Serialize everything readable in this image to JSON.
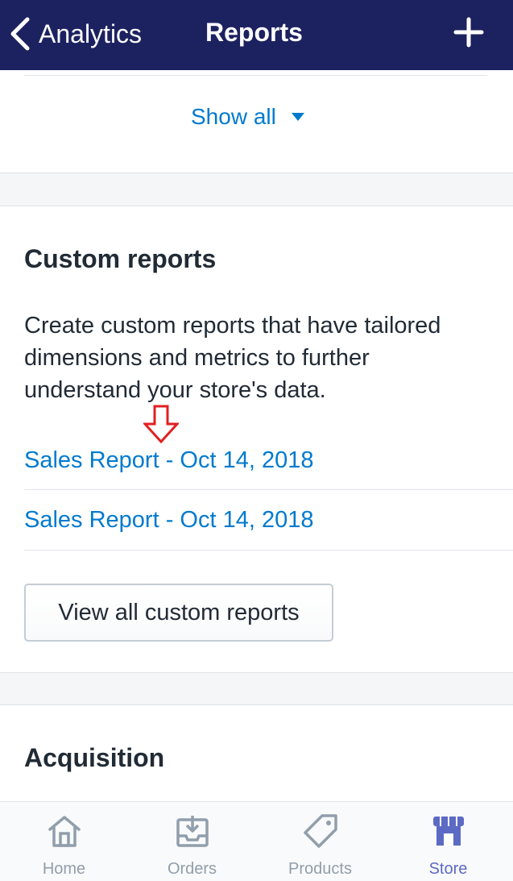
{
  "nav": {
    "back_label": "Analytics",
    "title": "Reports"
  },
  "show_all": {
    "label": "Show all"
  },
  "custom_reports": {
    "heading": "Custom reports",
    "description": "Create custom reports that have tailored dimensions and metrics to further understand your store's data.",
    "reports": [
      {
        "label": "Sales Report - Oct 14, 2018"
      },
      {
        "label": "Sales Report - Oct 14, 2018"
      }
    ],
    "view_all_label": "View all custom reports"
  },
  "acquisition": {
    "heading": "Acquisition"
  },
  "tabbar": {
    "tabs": [
      {
        "label": "Home",
        "icon": "home-icon"
      },
      {
        "label": "Orders",
        "icon": "orders-icon"
      },
      {
        "label": "Products",
        "icon": "tag-icon"
      },
      {
        "label": "Store",
        "icon": "store-icon",
        "active": true
      }
    ]
  },
  "colors": {
    "navbar": "#1c2260",
    "link": "#007ace",
    "active_tab": "#5c6ac4",
    "inactive_tab": "#919eab",
    "annotation_arrow": "#e02020"
  }
}
